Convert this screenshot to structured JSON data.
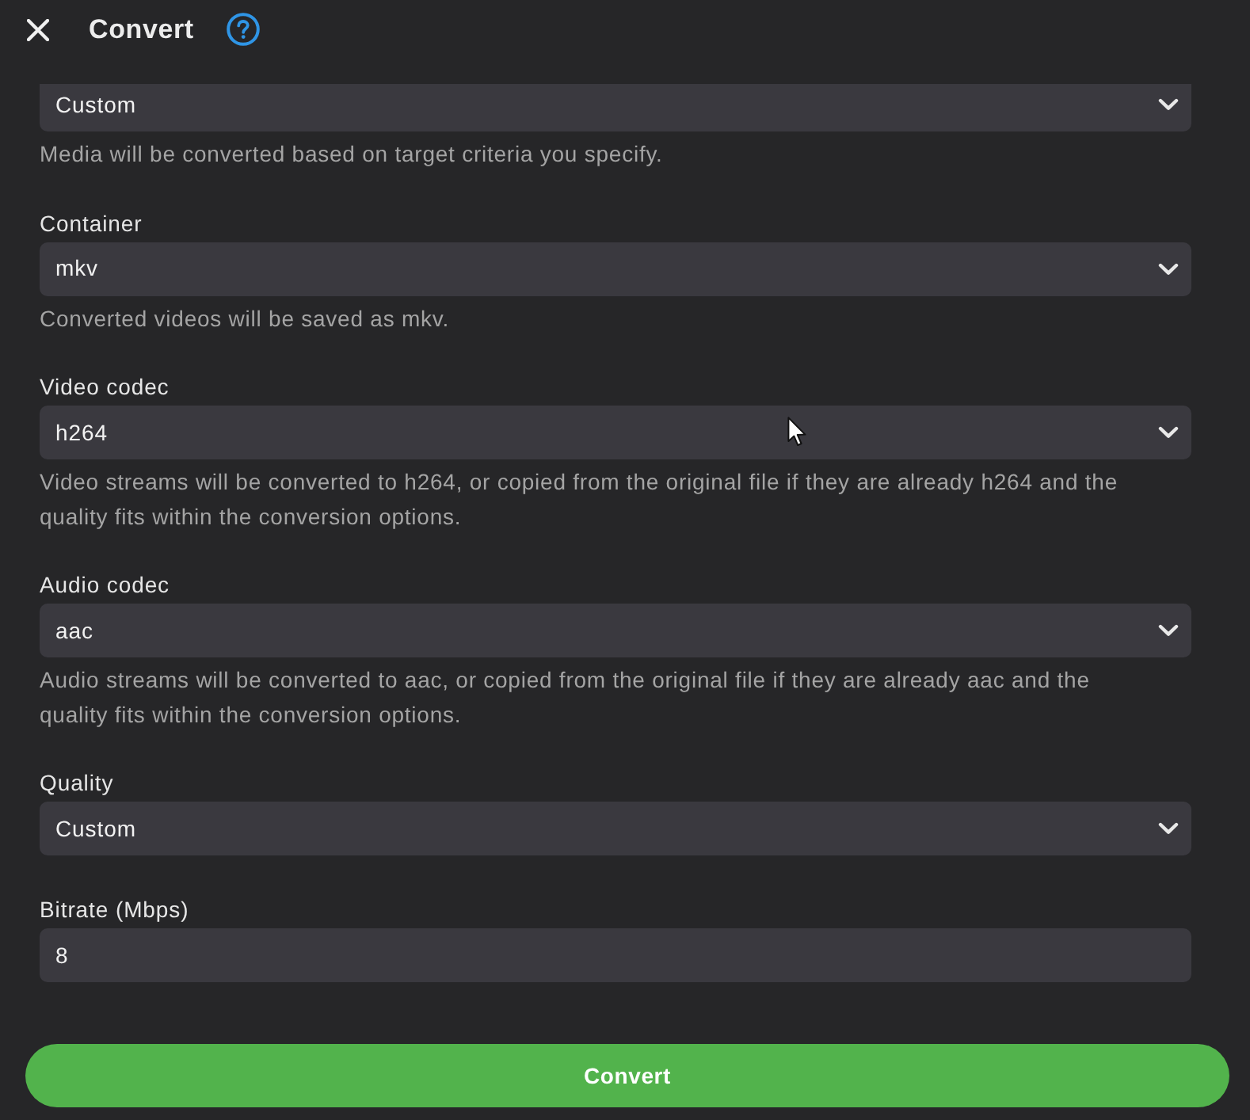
{
  "header": {
    "title": "Convert"
  },
  "fields": [
    {
      "kind": "select",
      "value": "Custom",
      "help": "Media will be converted based on target criteria you specify."
    },
    {
      "kind": "select",
      "label": "Container",
      "value": "mkv",
      "help": "Converted videos will be saved as mkv."
    },
    {
      "kind": "select",
      "label": "Video codec",
      "value": "h264",
      "help": "Video streams will be converted to h264, or copied from the original file if they are already h264 and the quality fits within the conversion options."
    },
    {
      "kind": "select",
      "label": "Audio codec",
      "value": "aac",
      "help": "Audio streams will be converted to aac, or copied from the original file if they are already aac and the quality fits within the conversion options."
    },
    {
      "kind": "select",
      "label": "Quality",
      "value": "Custom"
    },
    {
      "kind": "input",
      "label": "Bitrate (Mbps)",
      "value": "8"
    }
  ],
  "convert_button": {
    "label": "Convert"
  }
}
